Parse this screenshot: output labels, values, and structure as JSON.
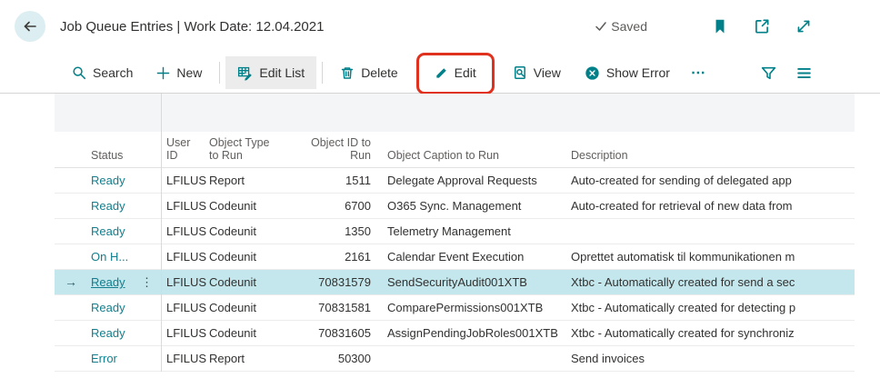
{
  "header": {
    "back_glyph": "←",
    "title": "Job Queue Entries | Work Date: 12.04.2021",
    "saved_label": "Saved"
  },
  "toolbar": {
    "search": "Search",
    "new": "New",
    "edit_list": "Edit List",
    "delete": "Delete",
    "edit": "Edit",
    "view": "View",
    "show_error": "Show Error",
    "more": "⋯"
  },
  "table": {
    "columns": [
      "Status",
      "User ID",
      "Object Type to Run",
      "Object ID to Run",
      "Object Caption to Run",
      "Description"
    ],
    "selected_arrow": "→",
    "row_options_glyph": "⋮",
    "rows": [
      {
        "selected": false,
        "status": "Ready",
        "user_id": "LFILUS",
        "object_type": "Report",
        "object_id": "1511",
        "caption": "Delegate Approval Requests",
        "description": "Auto-created for sending of delegated app"
      },
      {
        "selected": false,
        "status": "Ready",
        "user_id": "LFILUS",
        "object_type": "Codeunit",
        "object_id": "6700",
        "caption": "O365 Sync. Management",
        "description": "Auto-created for retrieval of new data from"
      },
      {
        "selected": false,
        "status": "Ready",
        "user_id": "LFILUS",
        "object_type": "Codeunit",
        "object_id": "1350",
        "caption": "Telemetry Management",
        "description": ""
      },
      {
        "selected": false,
        "status": "On H...",
        "user_id": "LFILUS",
        "object_type": "Codeunit",
        "object_id": "2161",
        "caption": "Calendar Event Execution",
        "description": "Oprettet automatisk til kommunikationen m"
      },
      {
        "selected": true,
        "status": "Ready",
        "user_id": "LFILUS",
        "object_type": "Codeunit",
        "object_id": "70831579",
        "caption": "SendSecurityAudit001XTB",
        "description": "Xtbc - Automatically created for send a sec"
      },
      {
        "selected": false,
        "status": "Ready",
        "user_id": "LFILUS",
        "object_type": "Codeunit",
        "object_id": "70831581",
        "caption": "ComparePermissions001XTB",
        "description": "Xtbc - Automatically created for detecting p"
      },
      {
        "selected": false,
        "status": "Ready",
        "user_id": "LFILUS",
        "object_type": "Codeunit",
        "object_id": "70831605",
        "caption": "AssignPendingJobRoles001XTB",
        "description": "Xtbc - Automatically created for synchroniz"
      },
      {
        "selected": false,
        "status": "Error",
        "user_id": "LFILUS",
        "object_type": "Report",
        "object_id": "50300",
        "caption": "",
        "description": "Send invoices"
      }
    ]
  },
  "colors": {
    "accent_teal": "#008089",
    "status_link": "#127e8d",
    "selected_row": "#c3e7ec",
    "annotation_red": "#e0301e"
  }
}
